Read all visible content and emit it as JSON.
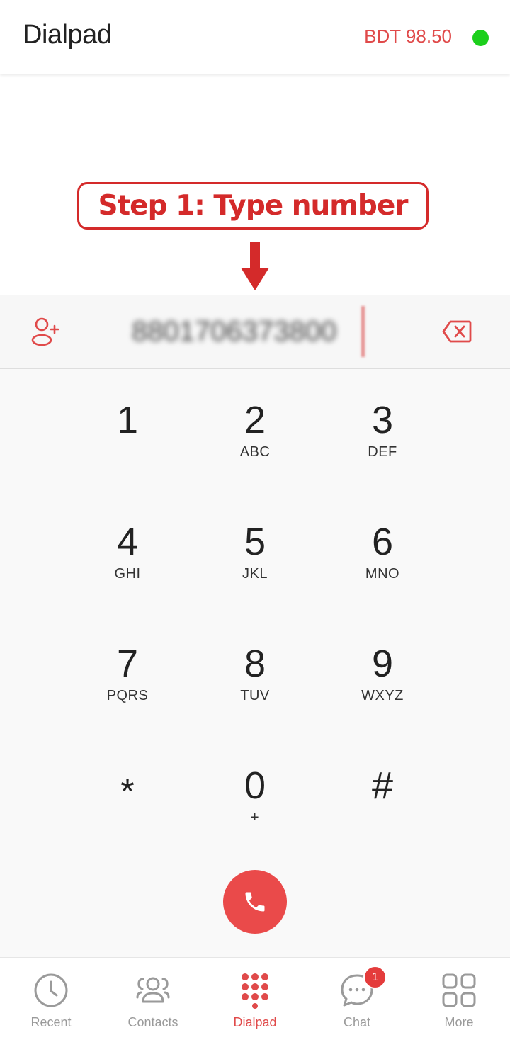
{
  "header": {
    "title": "Dialpad",
    "balance": "BDT 98.50",
    "status_color": "#1ccf1c"
  },
  "annotation": {
    "text": "Step 1: Type number",
    "color": "#d42a2a"
  },
  "number_row": {
    "value": "8801706373800",
    "add_contact_icon": "person-add-icon",
    "backspace_icon": "backspace-icon"
  },
  "keypad": {
    "keys": [
      {
        "digit": "1",
        "letters": ""
      },
      {
        "digit": "2",
        "letters": "ABC"
      },
      {
        "digit": "3",
        "letters": "DEF"
      },
      {
        "digit": "4",
        "letters": "GHI"
      },
      {
        "digit": "5",
        "letters": "JKL"
      },
      {
        "digit": "6",
        "letters": "MNO"
      },
      {
        "digit": "7",
        "letters": "PQRS"
      },
      {
        "digit": "8",
        "letters": "TUV"
      },
      {
        "digit": "9",
        "letters": "WXYZ"
      },
      {
        "digit": "*",
        "letters": ""
      },
      {
        "digit": "0",
        "letters": "+"
      },
      {
        "digit": "#",
        "letters": ""
      }
    ],
    "call_icon": "phone-icon",
    "accent_color": "#ea4a4a"
  },
  "bottom_nav": {
    "items": [
      {
        "label": "Recent",
        "icon": "clock-icon"
      },
      {
        "label": "Contacts",
        "icon": "contacts-icon"
      },
      {
        "label": "Dialpad",
        "icon": "dialpad-icon"
      },
      {
        "label": "Chat",
        "icon": "chat-icon"
      },
      {
        "label": "More",
        "icon": "grid-icon"
      }
    ],
    "active": "Dialpad",
    "chat_badge": "1"
  }
}
